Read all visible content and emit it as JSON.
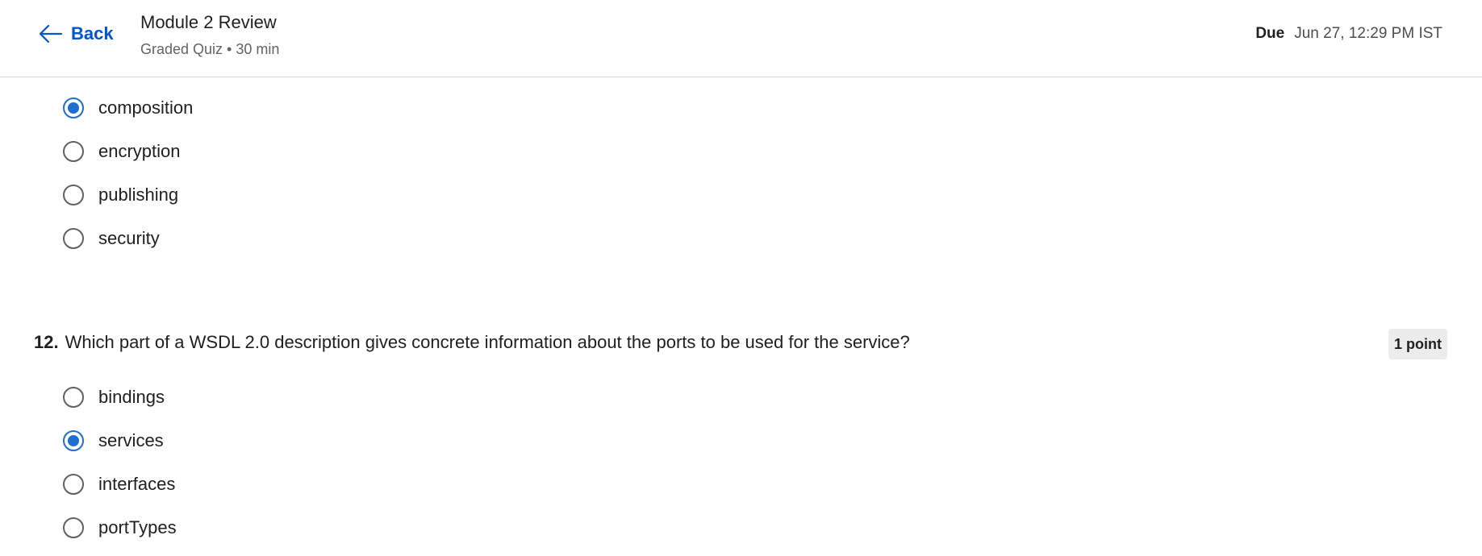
{
  "header": {
    "back_label": "Back",
    "module_title": "Module 2 Review",
    "quiz_meta": "Graded Quiz • 30 min",
    "due_label": "Due",
    "due_value": "Jun 27, 12:29 PM IST"
  },
  "question11": {
    "options": [
      {
        "label": "composition",
        "checked": true
      },
      {
        "label": "encryption",
        "checked": false
      },
      {
        "label": "publishing",
        "checked": false
      },
      {
        "label": "security",
        "checked": false
      }
    ]
  },
  "question12": {
    "number": "12.",
    "text": "Which part of a WSDL 2.0 description gives concrete information about the ports to be used for the service?",
    "points": "1 point",
    "options": [
      {
        "label": "bindings",
        "checked": false
      },
      {
        "label": "services",
        "checked": true
      },
      {
        "label": "interfaces",
        "checked": false
      },
      {
        "label": "portTypes",
        "checked": false
      }
    ]
  },
  "colors": {
    "accent": "#0056d2",
    "radio_selected": "#1f6fd0"
  },
  "icons": {
    "back": "arrow-left-icon"
  }
}
